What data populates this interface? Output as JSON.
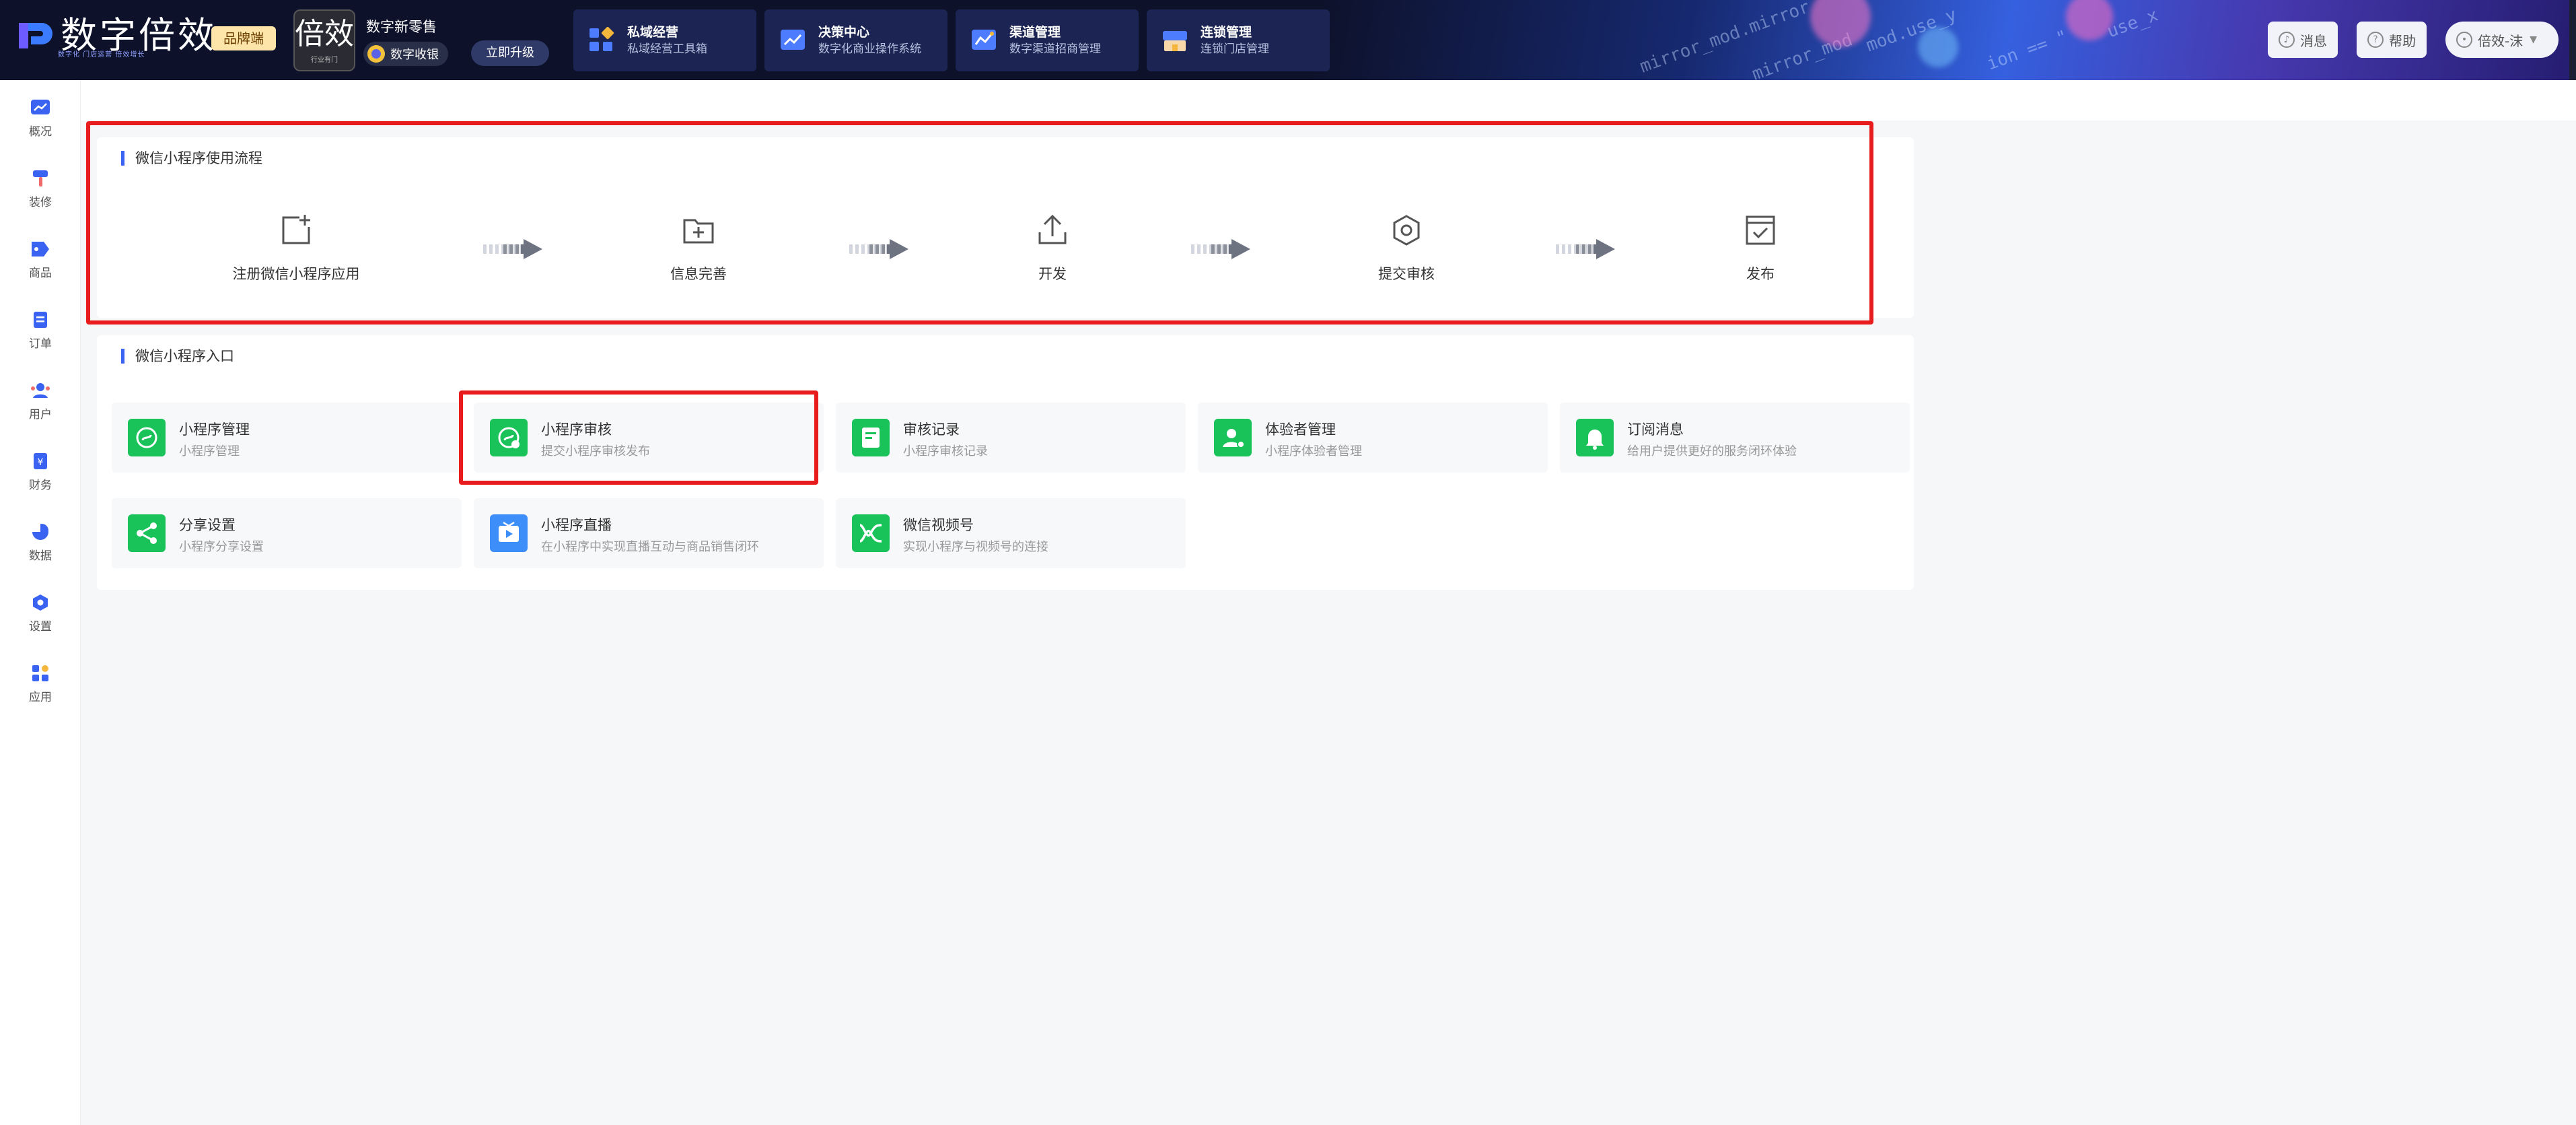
{
  "brand": {
    "logo_text": "数字倍效",
    "logo_sub": "数字化 门店运营 倍效增长",
    "badge": "品牌端"
  },
  "store": {
    "avatar_text": "倍效",
    "avatar_sub": "行业有门",
    "name": "数字新零售",
    "cash_chip": "数字收银",
    "upgrade": "立即升级"
  },
  "nav": [
    {
      "title": "私域经营",
      "subtitle": "私域经营工具箱"
    },
    {
      "title": "决策中心",
      "subtitle": "数字化商业操作系统"
    },
    {
      "title": "渠道管理",
      "subtitle": "数字渠道招商管理"
    },
    {
      "title": "连锁管理",
      "subtitle": "连锁门店管理"
    }
  ],
  "top_actions": {
    "message": "消息",
    "help": "帮助",
    "user": "倍效-沫"
  },
  "decor_code": [
    "mirror_mod.mirror",
    "mod.use_y",
    "mirror_mod",
    "ion == \"",
    "use_x"
  ],
  "sidebar": [
    {
      "label": "概况",
      "icon": "trend-icon"
    },
    {
      "label": "装修",
      "icon": "brush-icon"
    },
    {
      "label": "商品",
      "icon": "tag-icon"
    },
    {
      "label": "订单",
      "icon": "order-icon"
    },
    {
      "label": "用户",
      "icon": "users-icon"
    },
    {
      "label": "财务",
      "icon": "finance-icon"
    },
    {
      "label": "数据",
      "icon": "pie-icon"
    },
    {
      "label": "设置",
      "icon": "gear-icon"
    },
    {
      "label": "应用",
      "icon": "apps-icon"
    }
  ],
  "flow": {
    "title": "微信小程序使用流程",
    "steps": [
      {
        "label": "注册微信小程序应用",
        "icon": "add-square-icon"
      },
      {
        "label": "信息完善",
        "icon": "folder-plus-icon"
      },
      {
        "label": "开发",
        "icon": "upload-icon"
      },
      {
        "label": "提交审核",
        "icon": "settings-icon"
      },
      {
        "label": "发布",
        "icon": "check-square-icon"
      }
    ]
  },
  "entries": {
    "title": "微信小程序入口",
    "items": [
      {
        "title": "小程序管理",
        "subtitle": "小程序管理",
        "icon": "miniprogram-icon",
        "color": "#1ac35a"
      },
      {
        "title": "小程序审核",
        "subtitle": "提交小程序审核发布",
        "icon": "miniprogram-review-icon",
        "color": "#1ac35a"
      },
      {
        "title": "审核记录",
        "subtitle": "小程序审核记录",
        "icon": "record-icon",
        "color": "#1ac35a"
      },
      {
        "title": "体验者管理",
        "subtitle": "小程序体验者管理",
        "icon": "user-settings-icon",
        "color": "#1ac35a"
      },
      {
        "title": "订阅消息",
        "subtitle": "给用户提供更好的服务闭环体验",
        "icon": "bell-icon",
        "color": "#1ac35a"
      },
      {
        "title": "分享设置",
        "subtitle": "小程序分享设置",
        "icon": "share-icon",
        "color": "#1ac35a"
      },
      {
        "title": "小程序直播",
        "subtitle": "在小程序中实现直播互动与商品销售闭环",
        "icon": "live-icon",
        "color": "#3d8ef8"
      },
      {
        "title": "微信视频号",
        "subtitle": "实现小程序与视频号的连接",
        "icon": "channels-icon",
        "color": "#1ac35a"
      }
    ]
  }
}
